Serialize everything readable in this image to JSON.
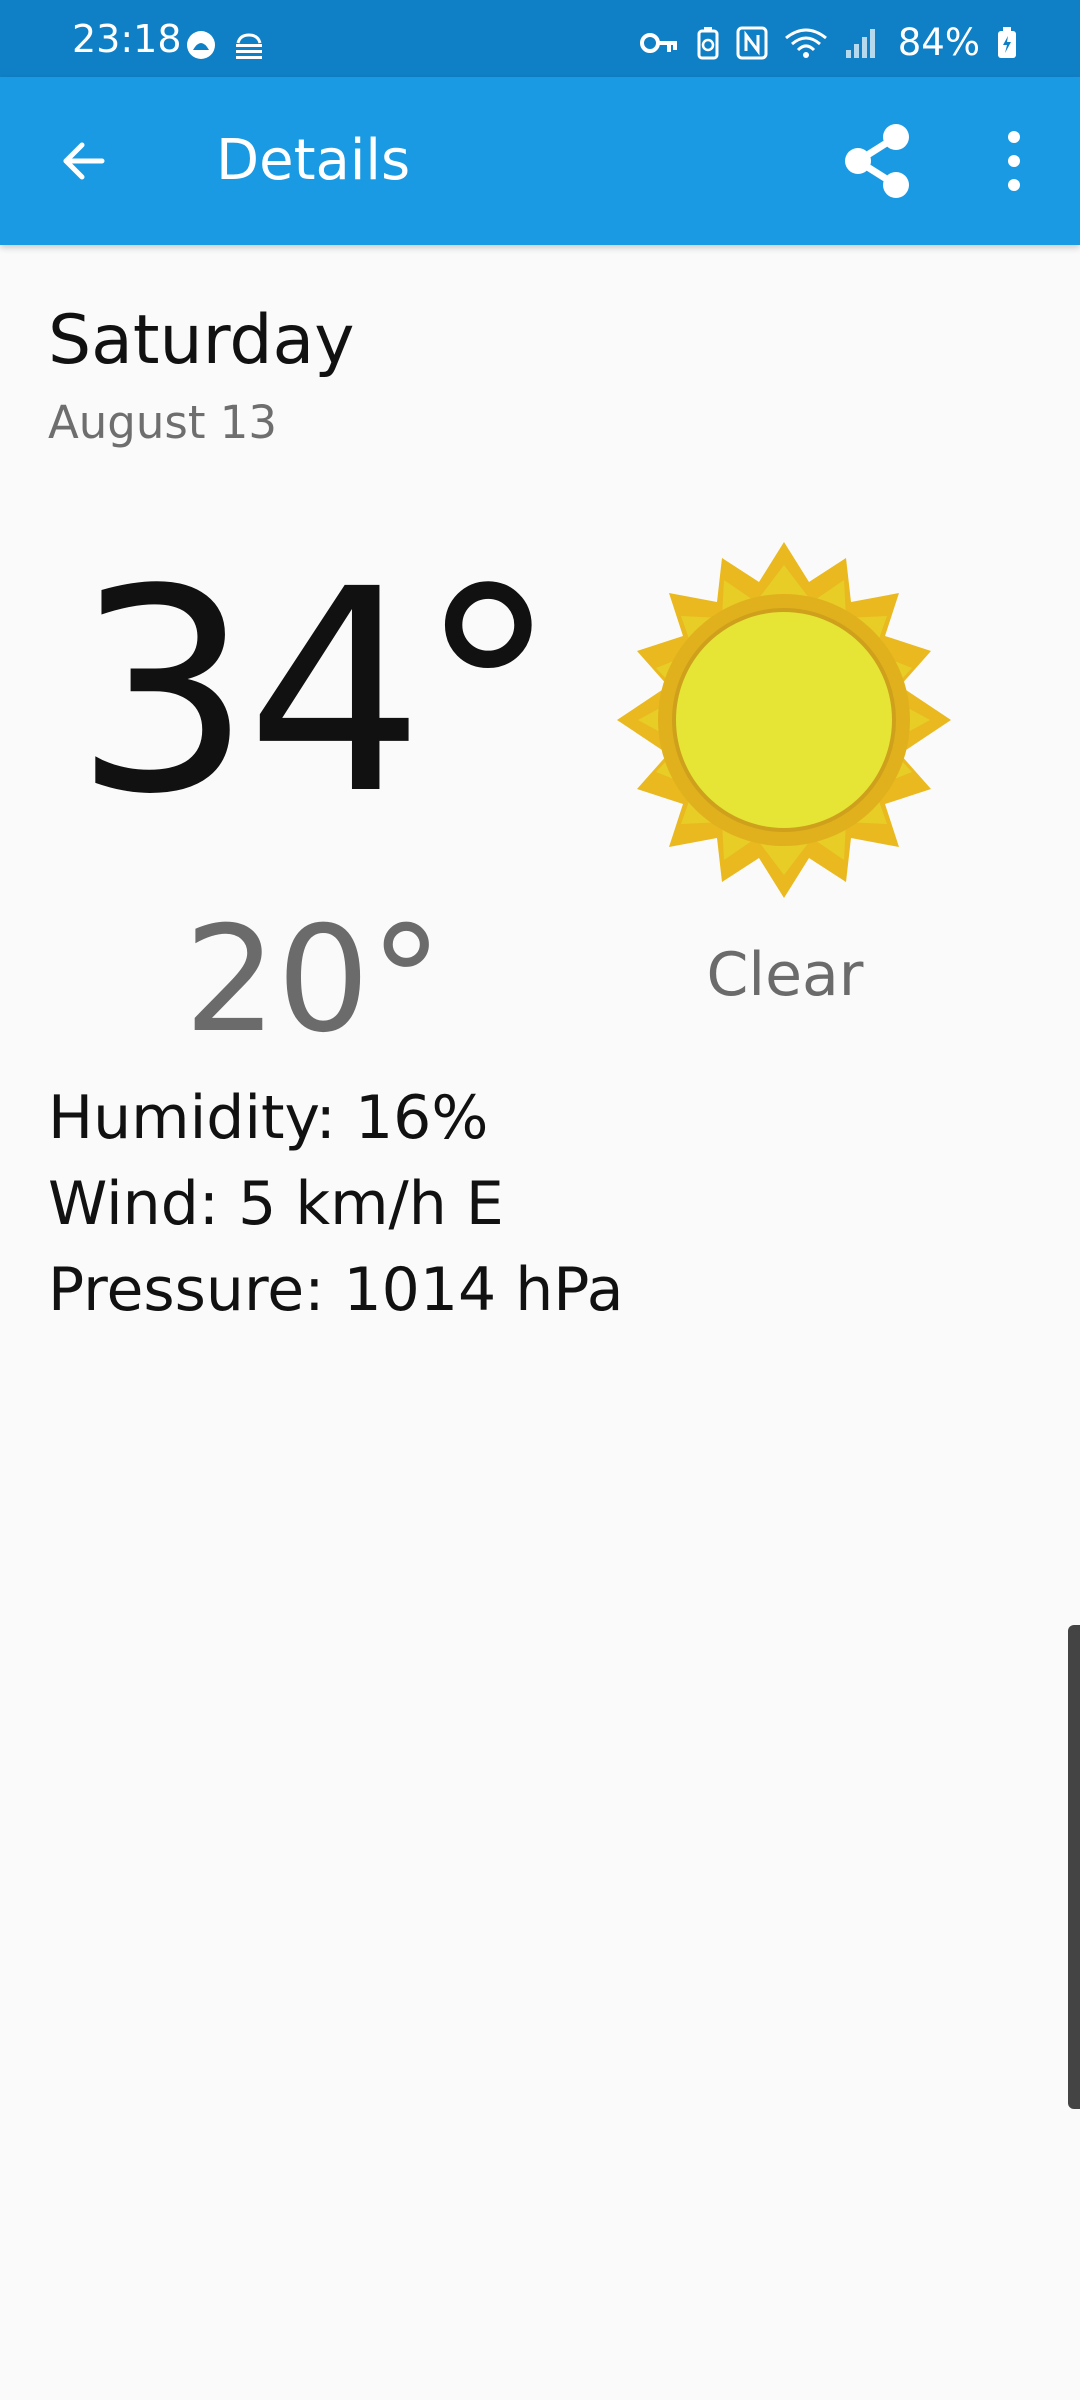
{
  "status_bar": {
    "time": "23:18",
    "battery": "84%",
    "icons": [
      "app-dot-icon",
      "cloud-icon",
      "key-icon",
      "battery-saver-icon",
      "nfc-icon",
      "wifi-icon",
      "signal-icon",
      "battery-icon"
    ]
  },
  "app_bar": {
    "title": "Details",
    "back_icon": "arrow-back-icon",
    "share_icon": "share-icon",
    "menu_icon": "more-vert-icon"
  },
  "forecast": {
    "day": "Saturday",
    "date": "August 13",
    "high": "34°",
    "low": "20°",
    "condition": "Clear",
    "condition_icon": "sun-icon",
    "humidity": "Humidity: 16%",
    "wind": "Wind: 5 km/h E",
    "pressure": "Pressure: 1014 hPa"
  },
  "colors": {
    "status_bar": "#0f80c6",
    "app_bar": "#1a9ae2",
    "background": "#fafafa",
    "sun_outer": "#e9b91f",
    "sun_inner": "#e6e435"
  }
}
